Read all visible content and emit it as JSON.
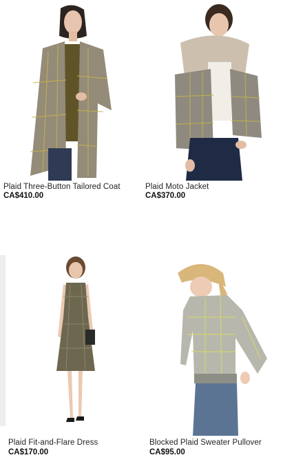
{
  "products": [
    {
      "name": "Plaid Three-Button Tailored Coat",
      "price": "CA$410.00"
    },
    {
      "name": "Plaid Moto Jacket",
      "price": "CA$370.00"
    },
    {
      "name": "Plaid Fit-and-Flare Dress",
      "price": "CA$170.00"
    },
    {
      "name": "Blocked Plaid Sweater Pullover",
      "price": "CA$95.00"
    }
  ]
}
